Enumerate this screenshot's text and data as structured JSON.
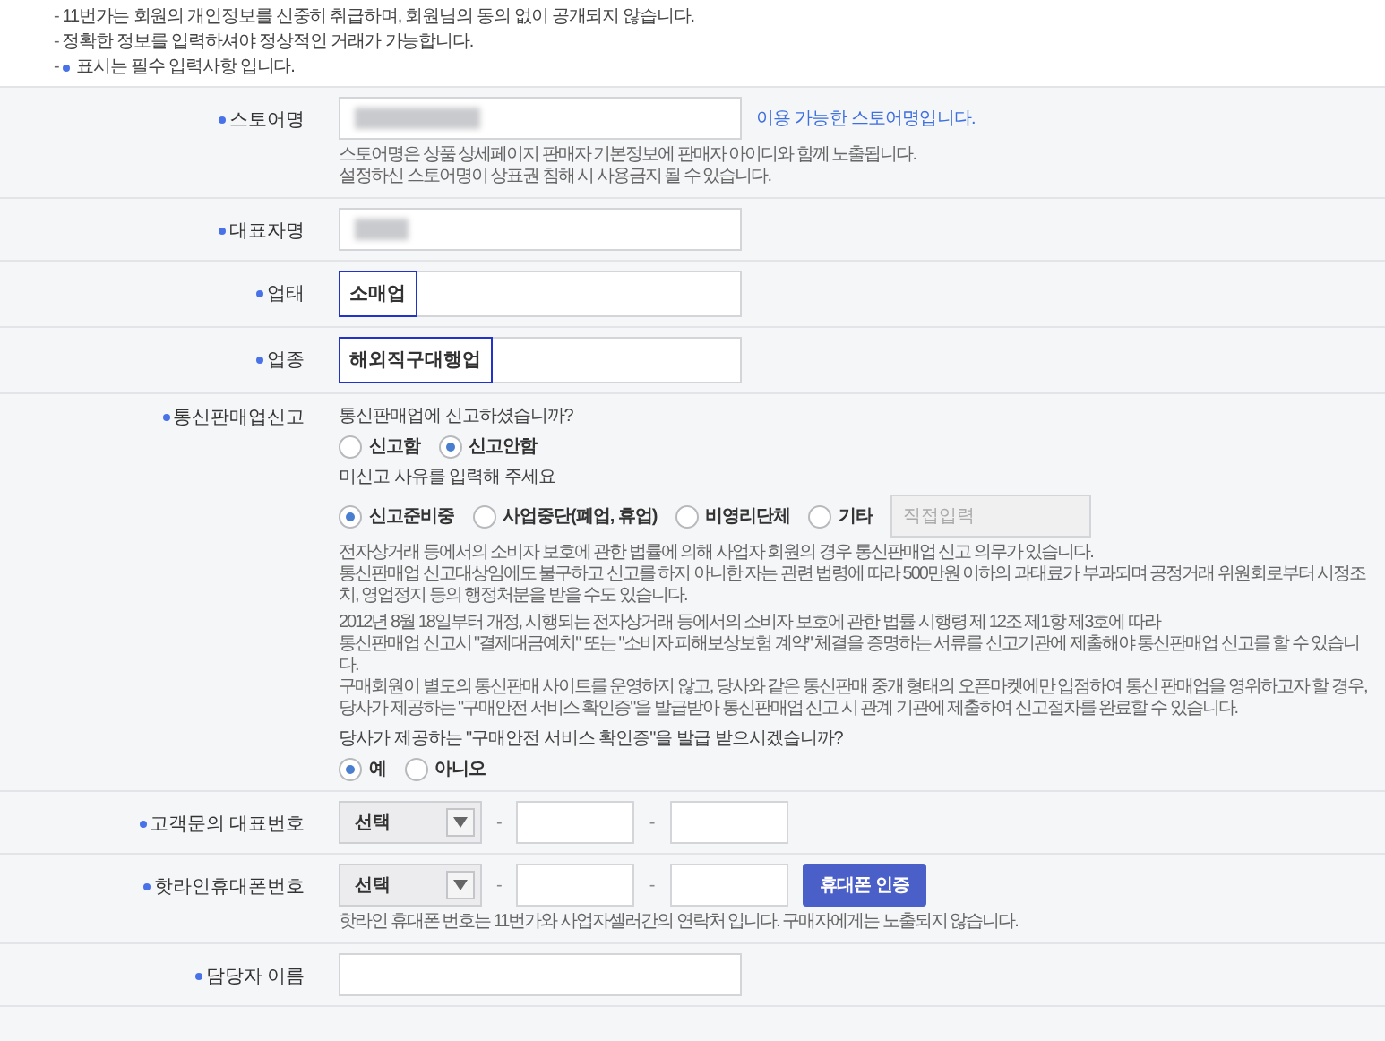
{
  "notices": [
    {
      "bullet": "-",
      "text": "11번가는 회원의 개인정보를 신중히 취급하며, 회원님의 동의 없이 공개되지 않습니다.",
      "required_mark": false
    },
    {
      "bullet": "-",
      "text": "정확한 정보를 입력하셔야 정상적인 거래가 가능합니다.",
      "required_mark": false
    },
    {
      "bullet": "-",
      "text": "표시는 필수 입력사항 입니다.",
      "required_mark": true
    }
  ],
  "rows": [
    {
      "kind": "text",
      "label": "스토어명",
      "required": true,
      "masked": true,
      "status": "이용 가능한 스토어명입니다.",
      "notes": [
        "스토어명은 상품 상세페이지 판매자 기본정보에 판매자 아이디와 함께 노출됩니다.",
        "설정하신 스토어명이 상표권 침해 시 사용금지 될 수 있습니다."
      ]
    },
    {
      "kind": "text",
      "label": "대표자명",
      "required": true,
      "masked": true
    },
    {
      "kind": "tag",
      "label": "업태",
      "required": true,
      "tag": "소매업"
    },
    {
      "kind": "tag",
      "label": "업종",
      "required": true,
      "tag": "해외직구대행업"
    },
    {
      "kind": "report",
      "label": "통신판매업신고",
      "required": true,
      "question": "통신판매업에 신고하셨습니까?",
      "options": [
        {
          "label": "신고함",
          "selected": false
        },
        {
          "label": "신고안함",
          "selected": true
        }
      ],
      "reason_prompt": "미신고 사유를 입력해 주세요",
      "reasons": [
        {
          "label": "신고준비중",
          "selected": true
        },
        {
          "label": "사업중단(폐업, 휴업)",
          "selected": false
        },
        {
          "label": "비영리단체",
          "selected": false
        },
        {
          "label": "기타",
          "selected": false
        }
      ],
      "other_placeholder": "직접입력",
      "paragraphs": [
        [
          "전자상거래 등에서의 소비자 보호에 관한 법률에 의해 사업자 회원의 경우 통신판매업 신고 의무가 있습니다.",
          "통신판매업 신고대상임에도 불구하고 신고를 하지 아니한 자는 관련 법령에 따라 500만원 이하의 과태료가 부과되며 공정거래 위원회로부터 시정조치, 영업정지 등의 행정처분을 받을 수도 있습니다."
        ],
        [
          "2012년 8월 18일부터 개정, 시행되는 전자상거래 등에서의 소비자 보호에 관한 법률 시행령 제 12조 제1항 제3호에 따라",
          "통신판매업 신고시 \"결제대금예치\" 또는 \"소비자 피해보상보험 계약\" 체결을 증명하는 서류를 신고기관에 제출해야 통신판매업 신고를 할 수 있습니다.",
          "구매회원이 별도의 통신판매 사이트를 운영하지 않고, 당사와 같은 통신판매 중개 형태의 오픈마켓에만 입점하여 통신 판매업을 영위하고자 할 경우,",
          "당사가 제공하는 \"구매안전 서비스 확인증\"을 발급받아 통신판매업 신고 시 관계 기관에 제출하여 신고절차를 완료할 수 있습니다."
        ]
      ],
      "confirm_question": "당사가 제공하는 \"구매안전 서비스 확인증\"을 발급 받으시겠습니까?",
      "confirm_options": [
        {
          "label": "예",
          "selected": true
        },
        {
          "label": "아니오",
          "selected": false
        }
      ]
    },
    {
      "kind": "phone",
      "label": "고객문의 대표번호",
      "required": true,
      "select_value": "선택",
      "separators": [
        "-",
        "-"
      ]
    },
    {
      "kind": "phone",
      "label": "핫라인휴대폰번호",
      "required": true,
      "select_value": "선택",
      "separators": [
        "-",
        "-"
      ],
      "button": "휴대폰 인증",
      "notes": [
        "핫라인 휴대폰 번호는 11번가와 사업자셀러간의 연락처 입니다. 구매자에게는 노출되지 않습니다."
      ]
    },
    {
      "kind": "text",
      "label": "담당자 이름",
      "required": true,
      "masked": false
    }
  ]
}
